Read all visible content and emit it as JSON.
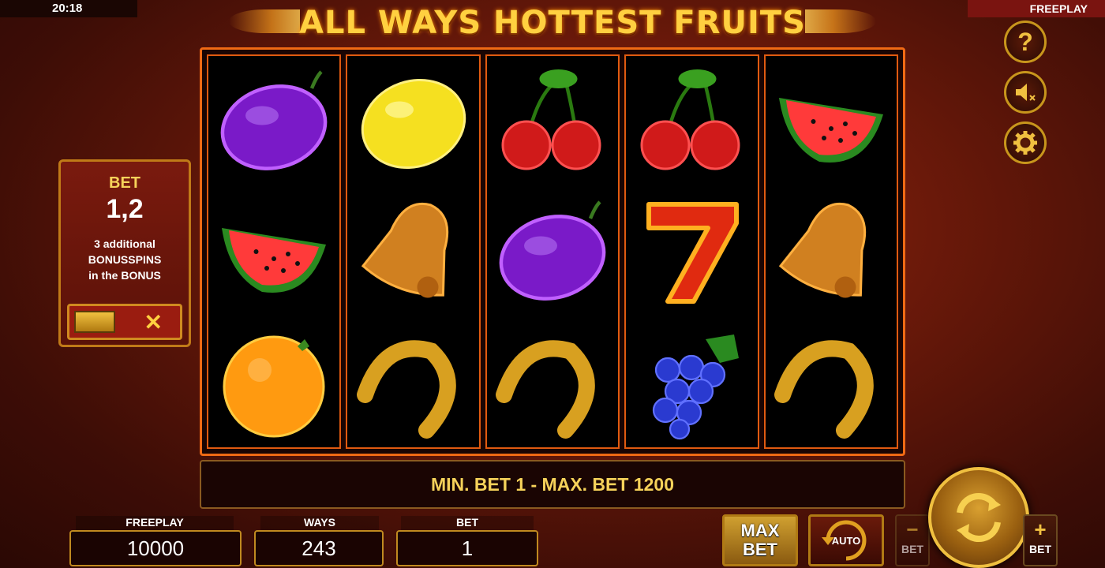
{
  "status": {
    "time": "20:18",
    "mode": "FREEPLAY"
  },
  "game": {
    "title": "ALL WAYS HOTTEST FRUITS"
  },
  "reels": [
    [
      "plum-icon",
      "watermelon-icon",
      "orange-icon"
    ],
    [
      "lemon-icon",
      "bell-icon",
      "horseshoe-icon"
    ],
    [
      "cherries-icon",
      "plum-icon",
      "horseshoe-icon"
    ],
    [
      "cherries-icon",
      "seven-icon",
      "grapes-icon"
    ],
    [
      "watermelon-icon",
      "bell-icon",
      "horseshoe-icon"
    ]
  ],
  "message": "MIN. BET 1 - MAX. BET 1200",
  "bet_panel": {
    "label": "BET",
    "value": "1,2",
    "info_line1": "3 additional",
    "info_line2": "BONUSSPINS",
    "info_line3": "in the BONUS"
  },
  "side_buttons": {
    "help": "?",
    "sound": "sound-muted-icon",
    "settings": "gear-icon"
  },
  "stats": {
    "freeplay_label": "FREEPLAY",
    "freeplay_value": "10000",
    "ways_label": "WAYS",
    "ways_value": "243",
    "bet_label": "BET",
    "bet_value": "1"
  },
  "controls": {
    "maxbet_line1": "MAX",
    "maxbet_line2": "BET",
    "auto_label": "AUTO",
    "bet_minus_symbol": "−",
    "bet_minus_label": "BET",
    "bet_plus_symbol": "+",
    "bet_plus_label": "BET"
  },
  "colors": {
    "accent": "#f0c040",
    "frame": "#f06a14",
    "panel": "#7a1a0e"
  }
}
